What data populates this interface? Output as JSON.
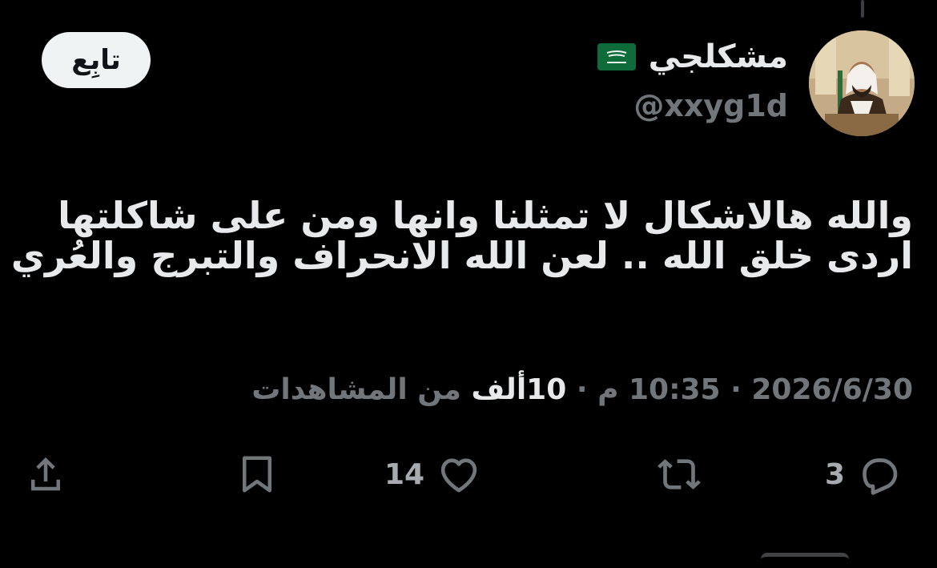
{
  "author": {
    "display_name": "مشكلجي",
    "handle": "@xxyg1d",
    "flag_icon": "saudi-flag-icon"
  },
  "follow_button": {
    "label": "تابِع"
  },
  "tweet": {
    "lines": [
      "والله هالاشكال لا تمثلنا وانها ومن على شاكلتها",
      "اردى خلق الله .. لعن الله الانحراف والتبرج والعُري"
    ]
  },
  "meta": {
    "date": "2026/6/30",
    "separator": "·",
    "time": "10:35 م",
    "views_count": "10ألف",
    "views_label": "من المشاهدات"
  },
  "actions": {
    "replies": "3",
    "retweets": "",
    "likes": "14"
  },
  "colors": {
    "background": "#000000",
    "text": "#e7e9ea",
    "secondary": "#71767b",
    "button_bg": "#eff3f4"
  }
}
